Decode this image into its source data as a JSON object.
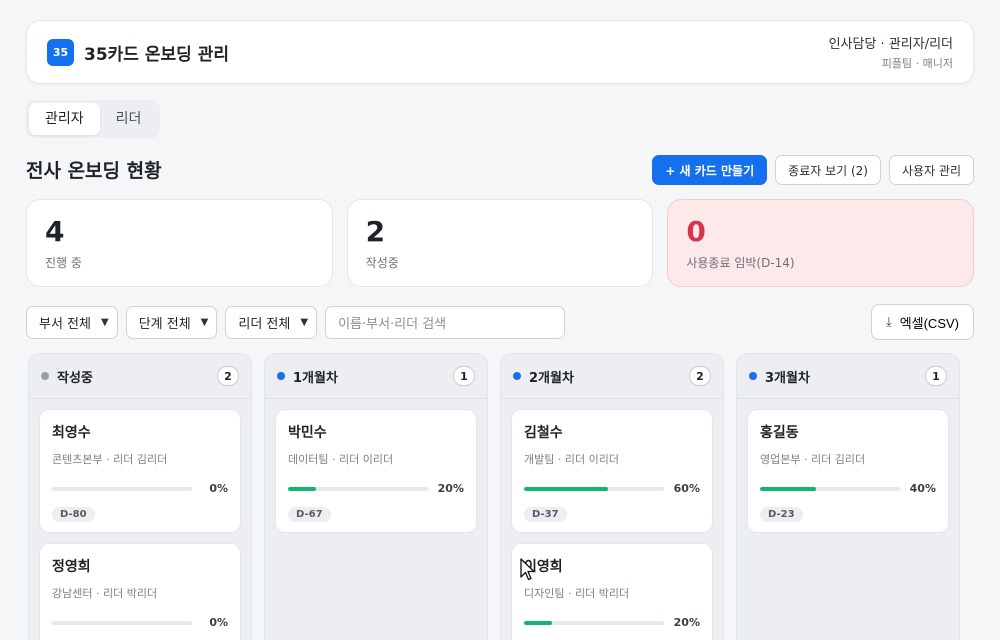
{
  "header": {
    "logo": "35",
    "title": "35카드 온보딩 관리",
    "user_role": "인사담당 · 관리자/리더",
    "user_team": "피플팀 · 매니저"
  },
  "tabs": [
    {
      "label": "관리자",
      "active": true
    },
    {
      "label": "리더",
      "active": false
    }
  ],
  "page": {
    "title": "전사 온보딩 현황",
    "new_card": "+ 새 카드 만들기",
    "retired": "종료자 보기 (2)",
    "users": "사용자 관리"
  },
  "stats": [
    {
      "value": "4",
      "label": "진행 중"
    },
    {
      "value": "2",
      "label": "작성중"
    },
    {
      "value": "0",
      "label": "사용종료 임박(D-14)"
    }
  ],
  "filters": {
    "department": "부서 전체",
    "stage": "단계 전체",
    "leader": "리더 전체",
    "search_placeholder": "이름·부서·리더 검색",
    "export": "엑셀(CSV)"
  },
  "colors": {
    "accent": "#1570ef",
    "progress": "#12b76a",
    "draft_dot": "#9aa0a8",
    "alert": "#d9344a"
  },
  "columns": [
    {
      "title": "작성중",
      "count": "2",
      "dot": "#9aa0a8",
      "cards": [
        {
          "name": "최영수",
          "meta": "콘텐츠본부 · 리더 김리더",
          "progress": 0,
          "progress_label": "0%",
          "dday": "D-80"
        },
        {
          "name": "정영희",
          "meta": "강남센터 · 리더 박리더",
          "progress": 0,
          "progress_label": "0%",
          "dday": ""
        }
      ]
    },
    {
      "title": "1개월차",
      "count": "1",
      "dot": "#1570ef",
      "cards": [
        {
          "name": "박민수",
          "meta": "데이터팀 · 리더 이리더",
          "progress": 20,
          "progress_label": "20%",
          "dday": "D-67"
        }
      ]
    },
    {
      "title": "2개월차",
      "count": "2",
      "dot": "#1570ef",
      "cards": [
        {
          "name": "김철수",
          "meta": "개발팀 · 리더 이리더",
          "progress": 60,
          "progress_label": "60%",
          "dday": "D-37"
        },
        {
          "name": "이영희",
          "meta": "디자인팀 · 리더 박리더",
          "progress": 20,
          "progress_label": "20%",
          "dday": ""
        }
      ]
    },
    {
      "title": "3개월차",
      "count": "1",
      "dot": "#1570ef",
      "cards": [
        {
          "name": "홍길동",
          "meta": "영업본부 · 리더 김리더",
          "progress": 40,
          "progress_label": "40%",
          "dday": "D-23"
        }
      ]
    }
  ]
}
